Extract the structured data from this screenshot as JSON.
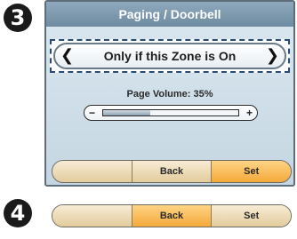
{
  "steps": {
    "step3": "3",
    "step4": "4"
  },
  "screen": {
    "title": "Paging / Doorbell",
    "selector": {
      "value": "Only if this Zone is On",
      "prev_icon": "chevron-left-icon",
      "next_icon": "chevron-right-icon"
    },
    "volume": {
      "label": "Page Volume: 35%",
      "level_percent": 35,
      "minus_label": "−",
      "plus_label": "+"
    },
    "buttons": [
      {
        "label": "",
        "active": false
      },
      {
        "label": "Back",
        "active": false
      },
      {
        "label": "Set",
        "active": true
      }
    ]
  },
  "step4_bar": {
    "buttons": [
      {
        "label": "",
        "active": false
      },
      {
        "label": "Back",
        "active": true
      },
      {
        "label": "Set",
        "active": false
      }
    ]
  },
  "colors": {
    "title_bar": "#7f9ab0",
    "button_normal": "#ecd7ad",
    "button_active": "#f7b34d",
    "selector_border": "#2a4a74"
  }
}
